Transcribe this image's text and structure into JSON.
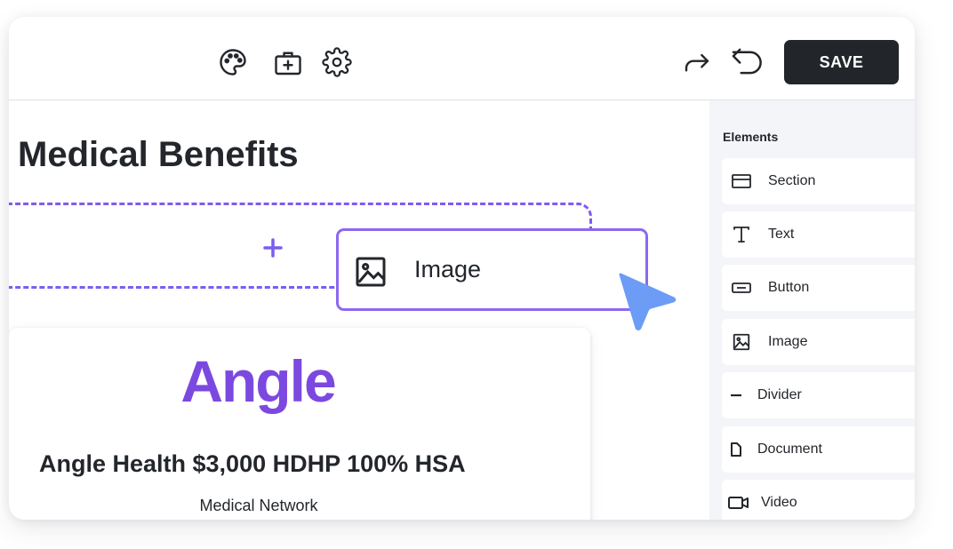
{
  "toolbar": {
    "save_label": "SAVE",
    "tools": [
      "palette-icon",
      "briefcase-icon",
      "gear-icon"
    ],
    "history": [
      "redo-icon",
      "undo-icon"
    ]
  },
  "canvas": {
    "page_title": "Medical Benefits",
    "card": {
      "logo_text": "Angle",
      "plan_title": "Angle Health $3,000 HDHP 100% HSA",
      "plan_subtitle": "Medical Network"
    }
  },
  "drag_preview": {
    "label": "Image",
    "icon": "image-icon"
  },
  "sidebar": {
    "heading": "Elements",
    "items": [
      {
        "label": "Section",
        "icon": "section-icon"
      },
      {
        "label": "Text",
        "icon": "text-icon"
      },
      {
        "label": "Button",
        "icon": "button-icon"
      },
      {
        "label": "Image",
        "icon": "image-icon"
      },
      {
        "label": "Divider",
        "icon": "divider-icon"
      },
      {
        "label": "Document",
        "icon": "document-icon"
      },
      {
        "label": "Video",
        "icon": "video-icon"
      }
    ]
  },
  "colors": {
    "accent": "#7d5cf0",
    "logo": "#7b49e0",
    "cursor": "#6c9cf5",
    "save_button": "#222529",
    "sidebar_bg": "#f4f5f9"
  }
}
